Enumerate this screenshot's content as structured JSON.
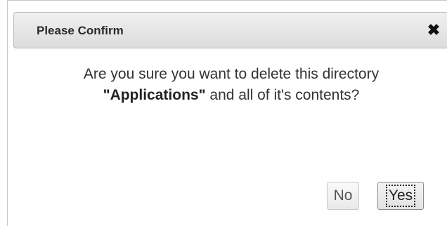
{
  "dialog": {
    "title": "Please Confirm",
    "close_glyph": "✖",
    "close_icon": "close-icon",
    "message": {
      "line1": "Are you sure you want to delete this directory",
      "name_quoted": "\"Applications\"",
      "line2_rest": "and all of it's contents?"
    },
    "buttons": {
      "no_label": "No",
      "yes_label": "Yes"
    }
  }
}
